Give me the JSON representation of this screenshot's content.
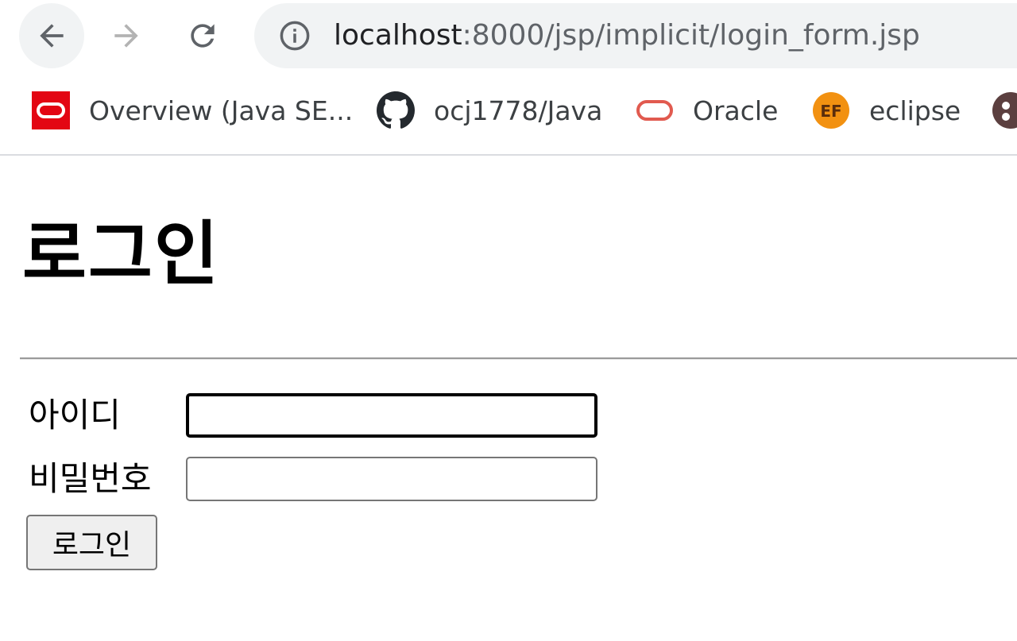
{
  "browser": {
    "url_host": "localhost",
    "url_path": ":8000/jsp/implicit/login_form.jsp",
    "nav": {
      "back_icon": "arrow-left-icon",
      "forward_icon": "arrow-right-icon",
      "reload_icon": "reload-icon",
      "info_icon": "info-icon"
    },
    "bookmarks": [
      {
        "label": "Overview (Java SE...",
        "icon": "oracle-icon",
        "color": "#e30613"
      },
      {
        "label": "ocj1778/Java",
        "icon": "github-icon",
        "color": "#24292e"
      },
      {
        "label": "Oracle",
        "icon": "oracle-outline-icon",
        "color": "#e15a4f"
      },
      {
        "label": "eclipse",
        "icon": "ef-icon",
        "color": "#f29111",
        "icon_text": "EF"
      },
      {
        "label": "",
        "icon": "partial-bookmark-icon",
        "color": "#5b3f3f"
      }
    ]
  },
  "page": {
    "heading": "로그인",
    "form": {
      "id_label": "아이디",
      "id_value": "",
      "password_label": "비밀번호",
      "password_value": "",
      "submit_label": "로그인"
    }
  }
}
